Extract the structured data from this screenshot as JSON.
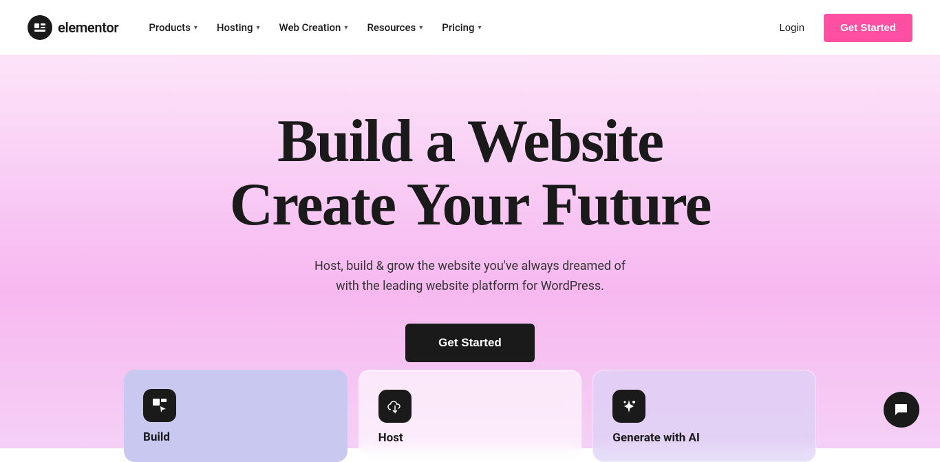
{
  "logo": {
    "icon_symbol": "⊟",
    "text": "elementor"
  },
  "navbar": {
    "menu_items": [
      {
        "id": "products",
        "label": "Products",
        "has_dropdown": true
      },
      {
        "id": "hosting",
        "label": "Hosting",
        "has_dropdown": true
      },
      {
        "id": "web-creation",
        "label": "Web Creation",
        "has_dropdown": true
      },
      {
        "id": "resources",
        "label": "Resources",
        "has_dropdown": true
      },
      {
        "id": "pricing",
        "label": "Pricing",
        "has_dropdown": true
      }
    ],
    "login_label": "Login",
    "get_started_label": "Get Started"
  },
  "hero": {
    "title_line1": "Build a Website",
    "title_line2": "Create Your Future",
    "subtitle_line1": "Host, build & grow the website you've always dreamed of",
    "subtitle_line2": "with the leading website platform for WordPress.",
    "cta_label": "Get Started"
  },
  "cards": [
    {
      "id": "build",
      "label": "Build",
      "icon_type": "cursor-icon"
    },
    {
      "id": "host",
      "label": "Host",
      "icon_type": "cloud-icon"
    },
    {
      "id": "ai",
      "label": "Generate with AI",
      "icon_type": "stars-icon"
    }
  ],
  "chat_widget": {
    "icon": "💬",
    "label": "Chat"
  },
  "colors": {
    "accent_pink": "#ff4fa3",
    "background_gradient_start": "#fce4f8",
    "background_gradient_end": "#f7b8f0",
    "dark": "#1a1a1a",
    "card_build_bg": "#c8c8f0",
    "card_host_bg": "rgba(255,255,255,0.6)",
    "card_ai_bg": "rgba(220,210,245,0.7)"
  }
}
